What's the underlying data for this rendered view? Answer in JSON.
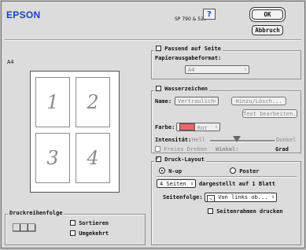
{
  "header": {
    "brand": "EPSON",
    "model": "SP 790 & 520",
    "help_label": "?",
    "ok_label": "OK",
    "cancel_label": "Abbruch"
  },
  "preview": {
    "paper_label": "A4",
    "pages": [
      "1",
      "2",
      "3",
      "4"
    ]
  },
  "fit_to_page": {
    "checkbox_label": "Passend auf Seite",
    "checked": false,
    "paper_format_label": "Papierausgabeformat:",
    "paper_format_value": "A4"
  },
  "watermark": {
    "checkbox_label": "Wasserzeichen",
    "checked": false,
    "name_label": "Name:",
    "name_value": "Vertraulich",
    "add_delete_label": "Hinzu/Lösch...",
    "edit_text_label": "Text bearbeiten...",
    "color_label": "Farbe:",
    "color_value": "Rot",
    "color_hex": "#e8686c",
    "intensity_label": "Intensität:",
    "intensity_light": "Hell",
    "intensity_dark": "Dunkel",
    "free_rotate_label": "Freies Drehen",
    "angle_label": "Winkel:",
    "angle_unit": "Grad"
  },
  "print_layout": {
    "checkbox_label": "Druck-Layout",
    "checked": true,
    "nup_label": "N-up",
    "poster_label": "Poster",
    "pages_value": "4 Seiten",
    "pages_suffix": "dargestellt auf 1 Blatt",
    "page_order_label": "Seitenfolge:",
    "page_order_value": "Von links ob...",
    "frame_label": "Seitenrahmen drucken"
  },
  "print_order": {
    "title": "Druckreihenfolge",
    "sort_label": "Sortieren",
    "reverse_label": "Umgekehrt"
  }
}
